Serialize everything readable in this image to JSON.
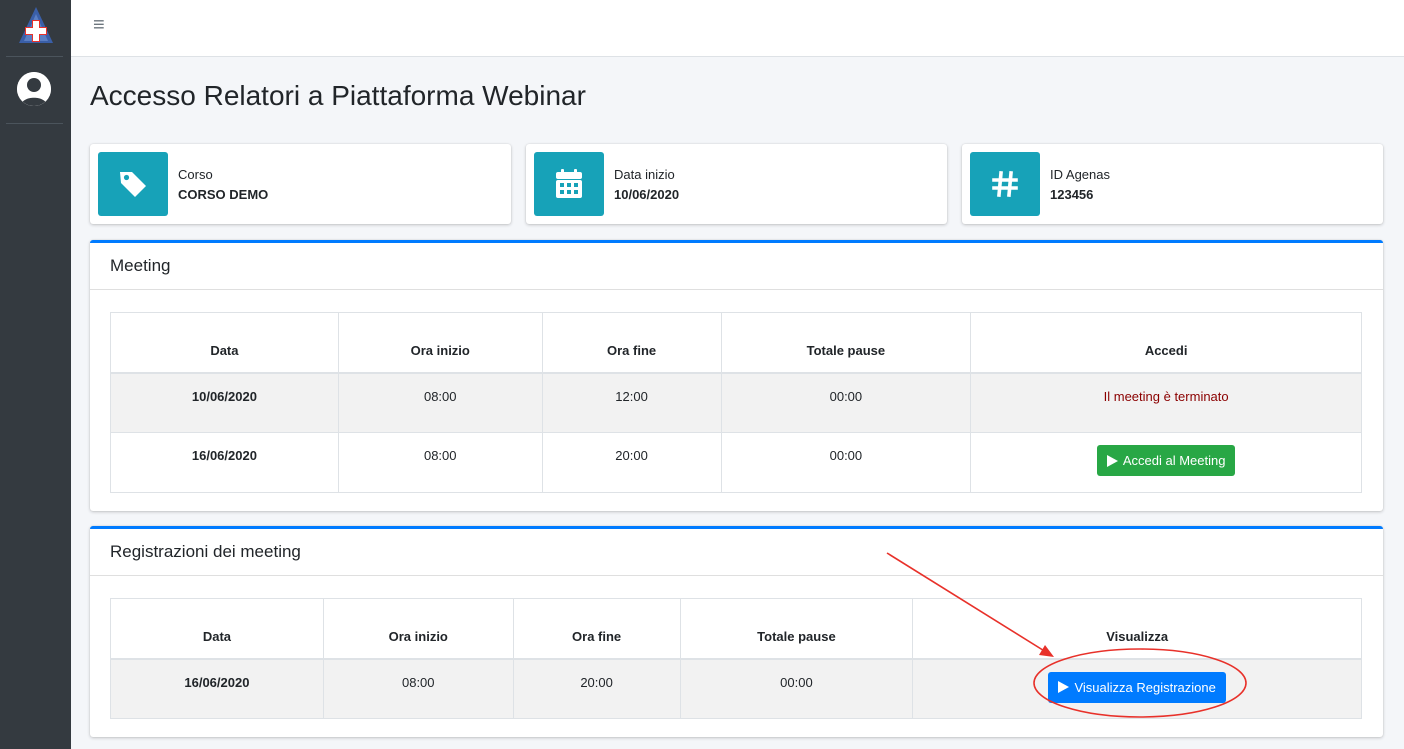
{
  "sidebar": {
    "logo_icon": "red-cross-logo-icon",
    "avatar_icon": "user-avatar-icon"
  },
  "topbar": {
    "menu_icon": "hamburger-menu-icon",
    "menu_glyph": "≡"
  },
  "page": {
    "title": "Accesso Relatori a Piattaforma Webinar"
  },
  "info_boxes": [
    {
      "label": "Corso",
      "value": "CORSO DEMO",
      "icon": "tag-icon"
    },
    {
      "label": "Data inizio",
      "value": "10/06/2020",
      "icon": "calendar-icon"
    },
    {
      "label": "ID Agenas",
      "value": "123456",
      "icon": "hashtag-icon"
    }
  ],
  "meeting": {
    "title": "Meeting",
    "columns": [
      "Data",
      "Ora inizio",
      "Ora fine",
      "Totale pause",
      "Accedi"
    ],
    "rows": [
      {
        "data": "10/06/2020",
        "ora_inizio": "08:00",
        "ora_fine": "12:00",
        "pause": "00:00",
        "status": "Il meeting è terminato"
      },
      {
        "data": "16/06/2020",
        "ora_inizio": "08:00",
        "ora_fine": "20:00",
        "pause": "00:00",
        "button": "Accedi al Meeting"
      }
    ]
  },
  "recordings": {
    "title": "Registrazioni dei meeting",
    "columns": [
      "Data",
      "Ora inizio",
      "Ora fine",
      "Totale pause",
      "Visualizza"
    ],
    "rows": [
      {
        "data": "16/06/2020",
        "ora_inizio": "08:00",
        "ora_fine": "20:00",
        "pause": "00:00",
        "button": "Visualizza Registrazione"
      }
    ]
  },
  "colors": {
    "accent": "#17a2b8",
    "primary": "#007bff",
    "success": "#28a745",
    "danger_text": "#8b0000",
    "annotation": "#e8312a"
  }
}
